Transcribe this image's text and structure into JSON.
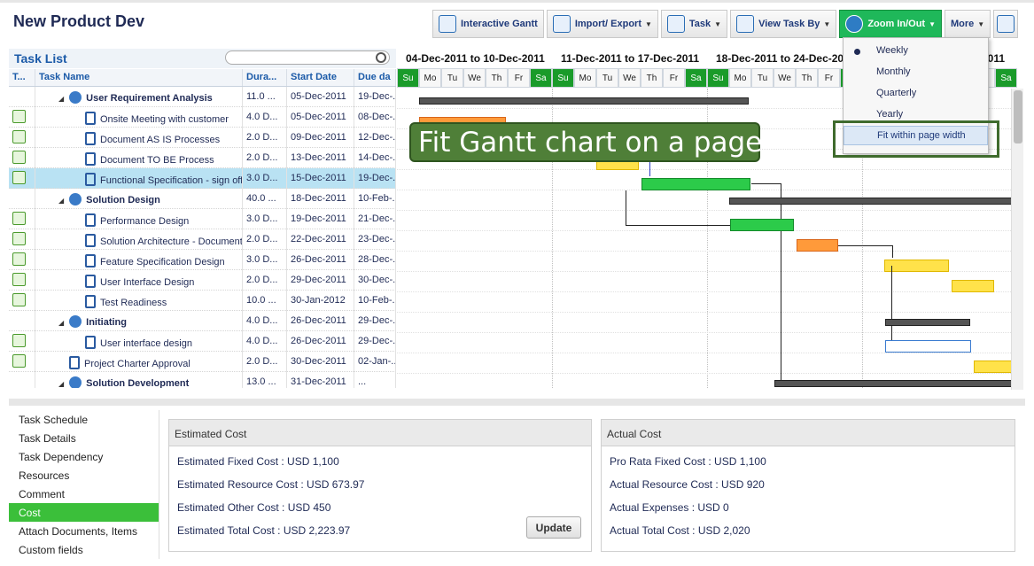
{
  "app": {
    "title": "New Product Dev"
  },
  "toolbar": {
    "interactive_gantt": "Interactive Gantt",
    "import_export": "Import/ Export",
    "task": "Task",
    "view_task_by": "View Task By",
    "zoom": "Zoom In/Out",
    "more": "More",
    "fullscreen_icon": "fullscreen-icon"
  },
  "task_list": {
    "title": "Task List",
    "headers": [
      "T...",
      "Task Name",
      "Dura...",
      "Start Date",
      "Due da"
    ],
    "rows": [
      {
        "name": "User Requirement Analysis",
        "duration": "11.0 ...",
        "start": "05-Dec-2011",
        "due": "19-Dec-..."
      },
      {
        "name": "Onsite Meeting with customer",
        "duration": "4.0 D...",
        "start": "05-Dec-2011",
        "due": "08-Dec-..."
      },
      {
        "name": "Document AS IS Processes",
        "duration": "2.0 D...",
        "start": "09-Dec-2011",
        "due": "12-Dec-..."
      },
      {
        "name": "Document TO BE Process",
        "duration": "2.0 D...",
        "start": "13-Dec-2011",
        "due": "14-Dec-..."
      },
      {
        "name": "Functional Specification - sign off",
        "duration": "3.0 D...",
        "start": "15-Dec-2011",
        "due": "19-Dec-..."
      },
      {
        "name": "Solution Design",
        "duration": "40.0 ...",
        "start": "18-Dec-2011",
        "due": "10-Feb-..."
      },
      {
        "name": "Performance Design",
        "duration": "3.0 D...",
        "start": "19-Dec-2011",
        "due": "21-Dec-..."
      },
      {
        "name": "Solution Architecture - Document",
        "duration": "2.0 D...",
        "start": "22-Dec-2011",
        "due": "23-Dec-..."
      },
      {
        "name": "Feature Specification Design",
        "duration": "3.0 D...",
        "start": "26-Dec-2011",
        "due": "28-Dec-..."
      },
      {
        "name": "User Interface Design",
        "duration": "2.0 D...",
        "start": "29-Dec-2011",
        "due": "30-Dec-..."
      },
      {
        "name": "Test Readiness",
        "duration": "10.0 ...",
        "start": "30-Jan-2012",
        "due": "10-Feb-..."
      },
      {
        "name": "Initiating",
        "duration": "4.0 D...",
        "start": "26-Dec-2011",
        "due": "29-Dec-..."
      },
      {
        "name": "User interface design",
        "duration": "4.0 D...",
        "start": "26-Dec-2011",
        "due": "29-Dec-..."
      },
      {
        "name": "Project Charter Approval",
        "duration": "2.0 D...",
        "start": "30-Dec-2011",
        "due": "02-Jan-..."
      },
      {
        "name": "Solution Development",
        "duration": "13.0 ...",
        "start": "31-Dec-2011",
        "due": "..."
      }
    ]
  },
  "gantt": {
    "weeks": [
      "04-Dec-2011 to 10-Dec-2011",
      "11-Dec-2011 to 17-Dec-2011",
      "18-Dec-2011 to 24-Dec-2011",
      "2011"
    ],
    "days": [
      "Su",
      "Mo",
      "Tu",
      "We",
      "Th",
      "Fr",
      "Sa",
      "Su",
      "Mo",
      "Tu",
      "We",
      "Th",
      "Fr",
      "Sa",
      "Su",
      "Mo",
      "Tu",
      "We",
      "Th",
      "Fr",
      "Sa",
      "Su",
      "Mo",
      "Tu",
      "We",
      "Th",
      "Fr",
      "Sa"
    ]
  },
  "zoom_menu": {
    "items": [
      "Weekly",
      "Monthly",
      "Quarterly",
      "Yearly",
      "Fit within page width"
    ],
    "selected": "Weekly"
  },
  "callout": {
    "text": "Fit Gantt chart on a page"
  },
  "bottom_nav": {
    "items": [
      "Task Schedule",
      "Task Details",
      "Task Dependency",
      "Resources",
      "Comment",
      "Cost",
      "Attach Documents, Items",
      "Custom fields"
    ],
    "active": "Cost"
  },
  "estimated_cost": {
    "title": "Estimated Cost",
    "lines": [
      "Estimated Fixed Cost : USD 1,100",
      "Estimated Resource Cost : USD 673.97",
      "Estimated Other Cost : USD 450",
      "Estimated Total Cost : USD 2,223.97"
    ],
    "update_label": "Update"
  },
  "actual_cost": {
    "title": "Actual Cost",
    "lines": [
      "Pro Rata Fixed Cost : USD 1,100",
      "Actual Resource Cost : USD 920",
      "Actual Expenses : USD 0",
      "Actual Total Cost : USD 2,020"
    ]
  }
}
